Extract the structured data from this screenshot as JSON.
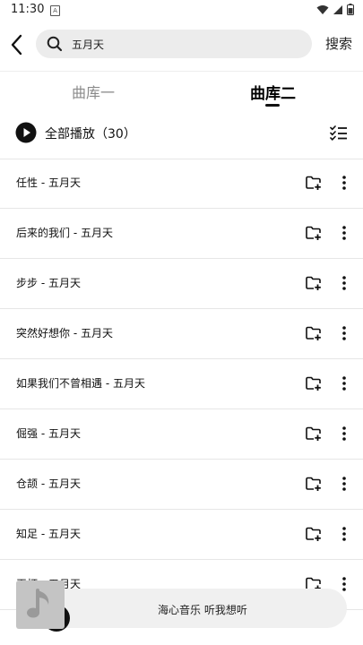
{
  "status_bar": {
    "time": "11:30",
    "sim_badge": "A"
  },
  "search": {
    "query": "五月天",
    "button_label": "搜索"
  },
  "tabs": [
    {
      "label": "曲库一",
      "active": false
    },
    {
      "label": "曲库二",
      "active": true
    }
  ],
  "play_all": {
    "label": "全部播放（30）"
  },
  "songs": [
    {
      "title": "任性 - 五月天"
    },
    {
      "title": "后来的我们 - 五月天"
    },
    {
      "title": "步步 - 五月天"
    },
    {
      "title": "突然好想你 - 五月天"
    },
    {
      "title": "如果我们不曾相遇 - 五月天"
    },
    {
      "title": "倔强 - 五月天"
    },
    {
      "title": "仓颉 - 五月天"
    },
    {
      "title": "知足 - 五月天"
    },
    {
      "title": "干杯 - 五月天"
    }
  ],
  "player": {
    "text": "海心音乐 听我想听"
  },
  "colors": {
    "accent": "#111111",
    "search_bg": "#ececec",
    "player_bg": "#f0f0f0",
    "divider": "#e6e6e6"
  },
  "icons": [
    "back-icon",
    "search-icon",
    "play-icon",
    "checklist-icon",
    "add-to-playlist-icon",
    "more-vert-icon",
    "music-note-icon",
    "wifi-icon",
    "signal-icon",
    "battery-icon"
  ]
}
